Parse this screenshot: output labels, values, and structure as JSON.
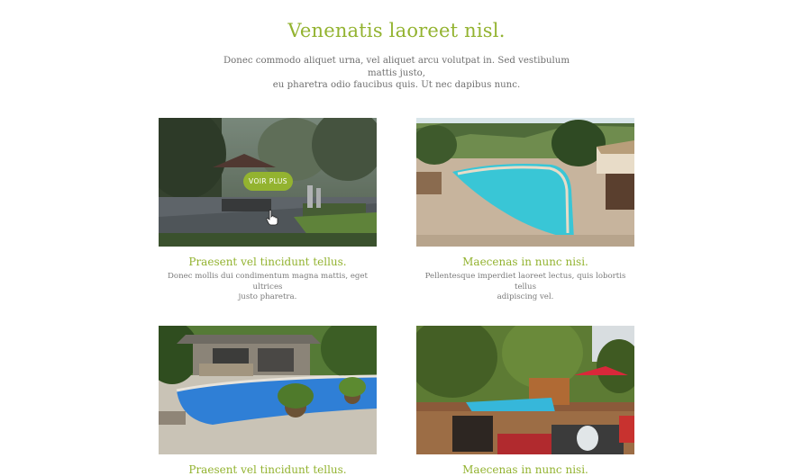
{
  "hero": {
    "title": "Venenatis laoreet nisl.",
    "text_line1": "Donec commodo aliquet urna, vel aliquet arcu volutpat in. Sed vestibulum mattis justo,",
    "text_line2": "eu pharetra odio faucibus quis. Ut nec dapibus nunc."
  },
  "colors": {
    "accent": "#93b330",
    "body_text": "#6f6f6f"
  },
  "cards": [
    {
      "title": "Praesent vel tincidunt tellus.",
      "desc_line1": "Donec mollis dui condimentum magna mattis, eget ultrices",
      "desc_line2": "justo pharetra.",
      "button": "VOIR PLUS",
      "image": "patio-garden-photo"
    },
    {
      "title": "Maecenas in nunc nisi.",
      "desc_line1": "Pellentesque imperdiet laoreet lectus, quis lobortis tellus",
      "desc_line2": "adipiscing vel.",
      "image": "curved-pool-photo"
    },
    {
      "title": "Praesent vel tincidunt tellus.",
      "image": "backyard-pool-photo"
    },
    {
      "title": "Maecenas in nunc nisi.",
      "image": "deck-pool-photo"
    }
  ],
  "icons": {
    "cursor": "hand-pointer-icon"
  }
}
